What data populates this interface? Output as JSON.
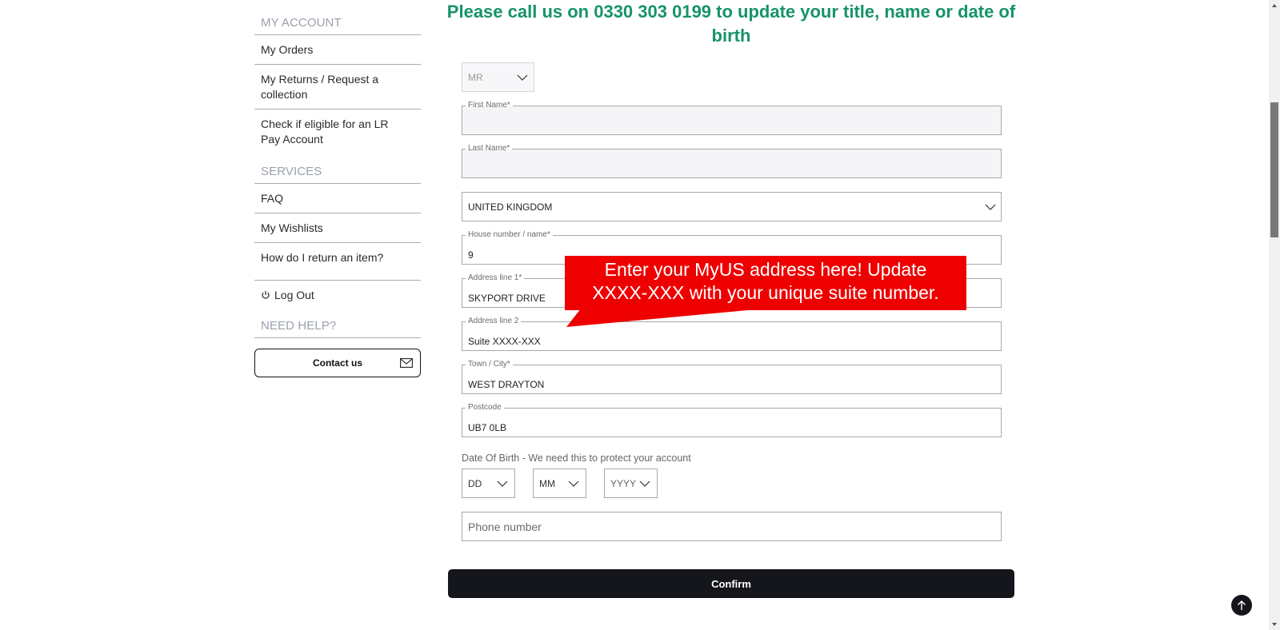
{
  "sidebar": {
    "my_account_heading": "MY ACCOUNT",
    "account_items": [
      {
        "label": "My Orders"
      },
      {
        "label": "My Returns / Request a collection"
      },
      {
        "label": "Check if eligible for an LR Pay Account"
      }
    ],
    "services_heading": "SERVICES",
    "services_items": [
      {
        "label": "FAQ"
      },
      {
        "label": "My Wishlists"
      },
      {
        "label": "How do I return an item?"
      }
    ],
    "logout_label": "Log Out",
    "help_heading": "NEED HELP?",
    "contact_label": "Contact us"
  },
  "main": {
    "notice": "Please call us on 0330 303 0199 to update your title, name or date of birth",
    "title_select": {
      "value": "MR"
    },
    "fields": {
      "first_name": {
        "label": "First Name*",
        "value": ""
      },
      "last_name": {
        "label": "Last Name*",
        "value": ""
      },
      "country": {
        "value": "UNITED KINGDOM"
      },
      "house": {
        "label": "House number / name*",
        "value": "9"
      },
      "address1": {
        "label": "Address line 1*",
        "value": "SKYPORT DRIVE"
      },
      "address2": {
        "label": "Address line 2",
        "value": "Suite XXXX-XXX"
      },
      "town": {
        "label": "Town / City*",
        "value": "WEST DRAYTON"
      },
      "postcode": {
        "label": "Postcode",
        "value": "UB7 0LB"
      },
      "phone": {
        "placeholder": "Phone number",
        "value": ""
      }
    },
    "dob": {
      "label": "Date Of Birth - We need this to protect your account",
      "day": "DD",
      "month": "MM",
      "year": "YYYY"
    },
    "confirm_label": "Confirm",
    "callout": {
      "line1": "Enter your MyUS address here! Update",
      "line2": "XXXX-XXX with your unique suite number.",
      "color": "#ee0000"
    }
  },
  "colors": {
    "notice": "#17936a",
    "button_dark": "#14161c"
  }
}
